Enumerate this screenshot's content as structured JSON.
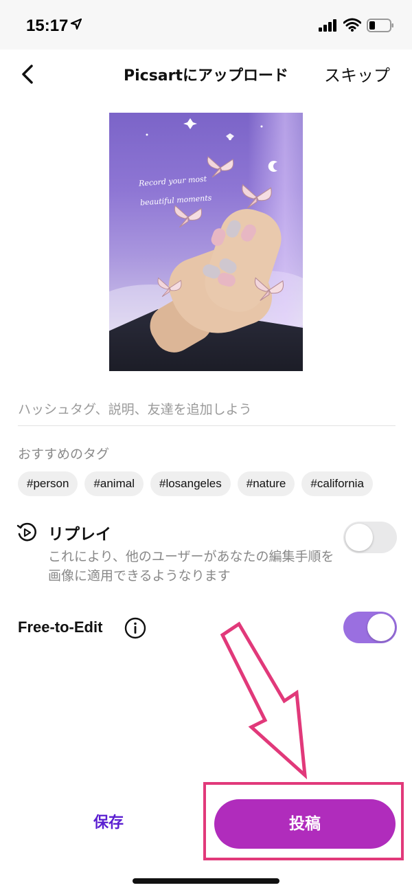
{
  "status_bar": {
    "time": "15:17",
    "icons": [
      "location-arrow-icon",
      "cellular-signal-icon",
      "wifi-icon",
      "battery-icon"
    ]
  },
  "nav": {
    "title": "Picsartにアップロード",
    "skip_label": "スキップ",
    "back_icon": "chevron-left-icon"
  },
  "preview": {
    "caption_line1": "Record your most",
    "caption_line2": "beautiful moments"
  },
  "description": {
    "placeholder": "ハッシュタグ、説明、友達を追加しよう",
    "value": ""
  },
  "recommended_tags": {
    "label": "おすすめのタグ",
    "tags": [
      "#person",
      "#animal",
      "#losangeles",
      "#nature",
      "#california"
    ]
  },
  "replay": {
    "title": "リプレイ",
    "description": "これにより、他のユーザーがあなたの編集手順を画像に適用できるようなります",
    "enabled": false,
    "icon": "replay-icon"
  },
  "free_to_edit": {
    "label": "Free-to-Edit",
    "enabled": true,
    "icon": "info-icon"
  },
  "actions": {
    "save_label": "保存",
    "post_label": "投稿"
  },
  "colors": {
    "accent_purple": "#9a6fe0",
    "post_button": "#b02cbc",
    "save_text": "#5b1fd1",
    "annotation": "#e1397a"
  }
}
